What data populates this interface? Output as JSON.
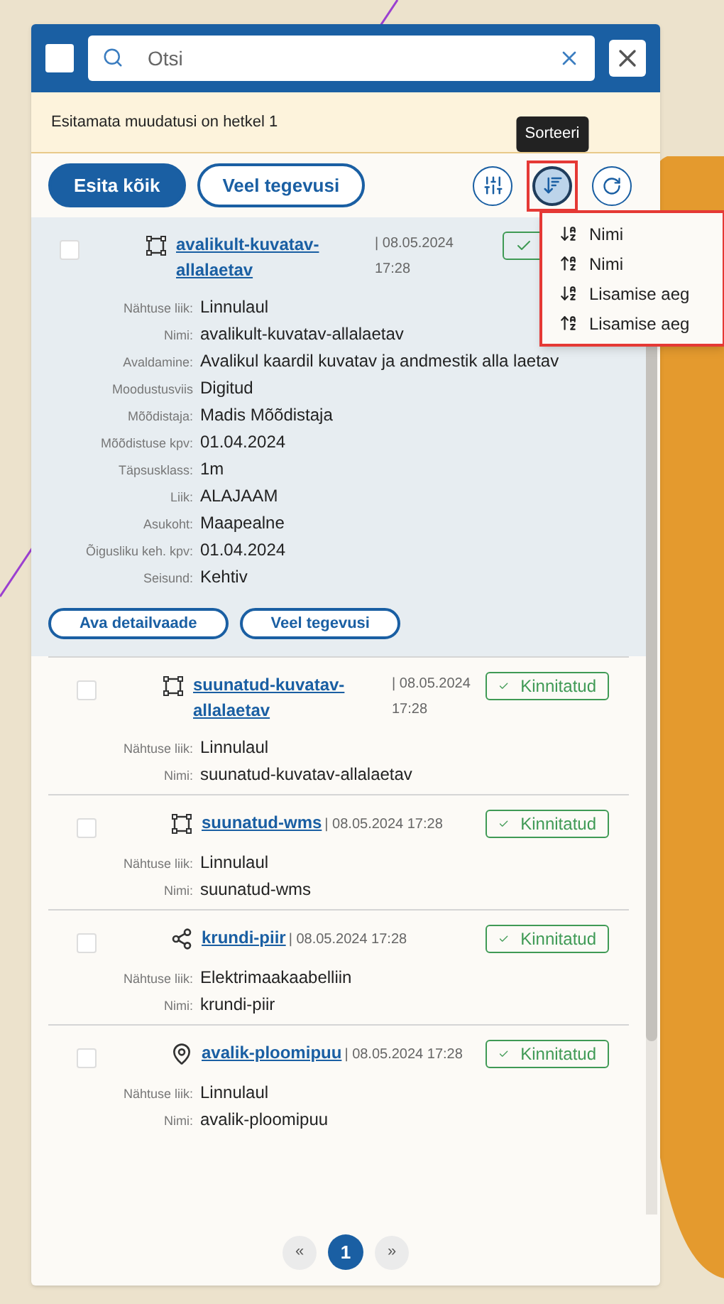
{
  "header": {
    "select_all": {
      "checked": false
    },
    "search": {
      "placeholder": "Otsi"
    }
  },
  "notice": "Esitamata muudatusi on hetkel 1",
  "toolbar": {
    "buttons": [
      {
        "label": "Esita kõik",
        "kind": "primary"
      },
      {
        "label": "Veel tegevusi",
        "kind": "outline"
      }
    ],
    "icon_buttons": [
      {
        "kind": "filter",
        "selected": false,
        "highlighted": false
      },
      {
        "kind": "sort",
        "selected": true,
        "highlighted": true,
        "tooltip": "Sorteeri"
      },
      {
        "kind": "refresh",
        "selected": false,
        "highlighted": false
      }
    ]
  },
  "sort_menu": {
    "highlighted": true,
    "items": [
      {
        "label": "Nimi",
        "kind": "descending"
      },
      {
        "label": "Nimi",
        "kind": "ascending"
      },
      {
        "label": "Lisamise aeg",
        "kind": "descending"
      },
      {
        "label": "Lisamise aeg",
        "kind": "ascending"
      }
    ]
  },
  "items": [
    {
      "title": "avalikult-kuvatav-allalaetav",
      "date": "| 08.05.2024 17:28",
      "kind": "polygon",
      "checked": false,
      "selected": true,
      "confirmed": true,
      "fields": [
        {
          "label": "Nähtuse liik:",
          "value": "Linnulaul"
        },
        {
          "label": "Nimi:",
          "value": "avalikult-kuvatav-allalaetav"
        },
        {
          "label": "Avaldamine:",
          "value": "Avalikul kaardil kuvatav ja andmestik alla laetav"
        },
        {
          "label": "Moodustusviis",
          "value": "Digitud"
        },
        {
          "label": "Mõõdistaja:",
          "value": "Madis Mõõdistaja"
        },
        {
          "label": "Mõõdistuse kpv:",
          "value": "01.04.2024"
        },
        {
          "label": "Täpsusklass:",
          "value": "1m"
        },
        {
          "label": "Liik:",
          "value": "ALAJAAM"
        },
        {
          "label": "Asukoht:",
          "value": "Maapealne"
        },
        {
          "label": "Õigusliku keh. kpv:",
          "value": "01.04.2024"
        },
        {
          "label": "Seisund:",
          "value": "Kehtiv"
        }
      ],
      "actions": [
        "Ava detailvaade",
        "Veel tegevusi"
      ]
    },
    {
      "title": "suunatud-kuvatav-allalaetav",
      "date": "| 08.05.2024 17:28",
      "kind": "polygon",
      "checked": false,
      "selected": false,
      "confirmed": true,
      "status": "Kinnitatud",
      "fields": [
        {
          "label": "Nähtuse liik:",
          "value": "Linnulaul"
        },
        {
          "label": "Nimi:",
          "value": "suunatud-kuvatav-allalaetav"
        }
      ]
    },
    {
      "title": "suunatud-wms",
      "date": "| 08.05.2024 17:28",
      "kind": "polygon",
      "checked": false,
      "selected": false,
      "confirmed": true,
      "status": "Kinnitatud",
      "fields": [
        {
          "label": "Nähtuse liik:",
          "value": "Linnulaul"
        },
        {
          "label": "Nimi:",
          "value": "suunatud-wms"
        }
      ]
    },
    {
      "title": "krundi-piir",
      "date": "| 08.05.2024 17:28",
      "kind": "line",
      "checked": false,
      "selected": false,
      "confirmed": true,
      "status": "Kinnitatud",
      "fields": [
        {
          "label": "Nähtuse liik:",
          "value": "Elektrimaakaabelliin"
        },
        {
          "label": "Nimi:",
          "value": "krundi-piir"
        }
      ]
    },
    {
      "title": "avalik-ploomipuu",
      "date": "| 08.05.2024 17:28",
      "kind": "point",
      "checked": false,
      "selected": false,
      "confirmed": true,
      "status": "Kinnitatud",
      "fields": [
        {
          "label": "Nähtuse liik:",
          "value": "Linnulaul"
        },
        {
          "label": "Nimi:",
          "value": "avalik-ploomipuu"
        }
      ]
    }
  ],
  "pagination": {
    "prev": "«",
    "next": "»",
    "pages": [
      {
        "label": "1",
        "selected": true
      }
    ]
  }
}
